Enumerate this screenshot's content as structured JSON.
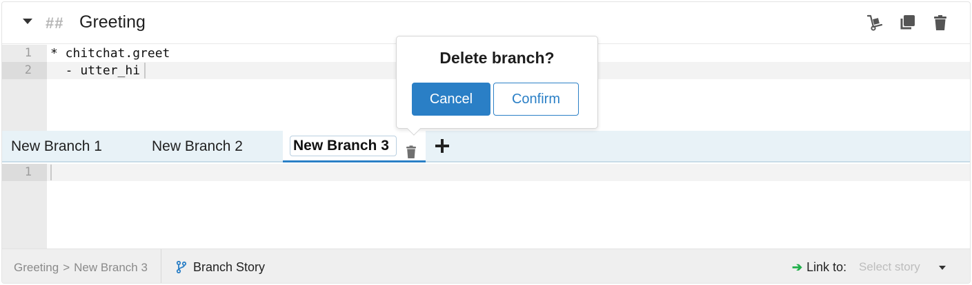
{
  "header": {
    "heading_marker": "##",
    "title": "Greeting",
    "icons": [
      "dolly-icon",
      "copy-icon",
      "trash-icon"
    ]
  },
  "story_editor": {
    "lines": [
      {
        "number": "1",
        "text": "* chitchat.greet"
      },
      {
        "number": "2",
        "text": "  - utter_hi"
      }
    ]
  },
  "branches": {
    "tabs": [
      {
        "label": "New Branch 1"
      },
      {
        "label": "New Branch 2"
      },
      {
        "label": "New Branch 3"
      }
    ],
    "active_index": 2,
    "add_icon": "plus-icon"
  },
  "branch_editor": {
    "lines": [
      {
        "number": "1",
        "text": ""
      }
    ]
  },
  "popover": {
    "title": "Delete branch?",
    "cancel_label": "Cancel",
    "confirm_label": "Confirm"
  },
  "footer": {
    "breadcrumb": [
      "Greeting",
      ">",
      "New Branch 3"
    ],
    "branch_story_label": "Branch Story",
    "link_to_label": "Link to:",
    "select_placeholder": "Select story"
  },
  "colors": {
    "accent": "#2a7fc6",
    "tab_bar": "#e8f2f7",
    "link_arrow": "#21b04b"
  }
}
